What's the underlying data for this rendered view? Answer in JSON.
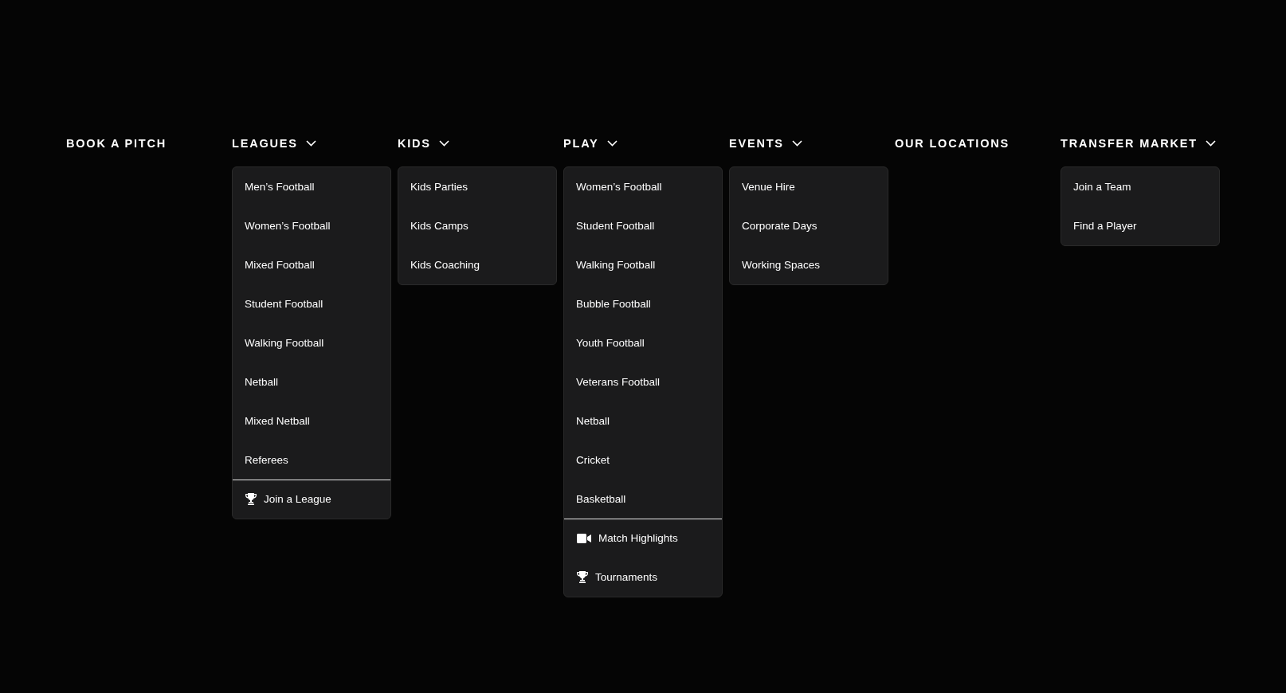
{
  "nav": [
    {
      "label": "BOOK A PITCH",
      "kind": "link"
    },
    {
      "label": "LEAGUES",
      "kind": "menu",
      "items": [
        "Men’s Football",
        "Women’s Football",
        "Mixed Football",
        "Student Football",
        "Walking Football",
        "Netball",
        "Mixed Netball",
        "Referees"
      ],
      "extras": [
        {
          "label": "Join a League",
          "kind": "trophy"
        }
      ]
    },
    {
      "label": "KIDS",
      "kind": "menu",
      "items": [
        "Kids Parties",
        "Kids Camps",
        "Kids Coaching"
      ]
    },
    {
      "label": "PLAY",
      "kind": "menu",
      "items": [
        "Women’s Football",
        "Student Football",
        "Walking Football",
        "Bubble Football",
        "Youth Football",
        "Veterans Football",
        "Netball",
        "Cricket",
        "Basketball"
      ],
      "extras": [
        {
          "label": "Match Highlights",
          "kind": "video"
        },
        {
          "label": "Tournaments",
          "kind": "trophy"
        }
      ]
    },
    {
      "label": "EVENTS",
      "kind": "menu",
      "items": [
        "Venue Hire",
        "Corporate Days",
        "Working Spaces"
      ]
    },
    {
      "label": "OUR LOCATIONS",
      "kind": "link"
    },
    {
      "label": "TRANSFER MARKET",
      "kind": "menu",
      "items": [
        "Join a Team",
        "Find a Player"
      ]
    }
  ]
}
